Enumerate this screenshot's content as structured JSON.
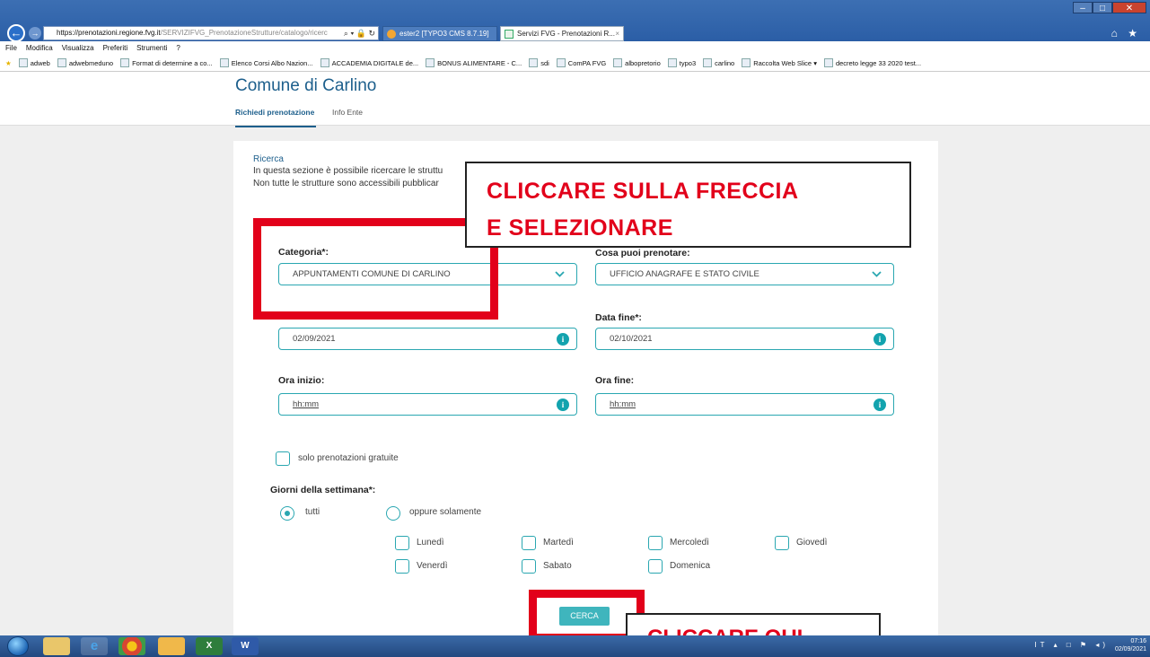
{
  "browser": {
    "url_host": "https://prenotazioni.regione.fvg.it",
    "url_rest": "/SERVIZIFVG_PrenotazioneStrutture/catalogo/ricerc",
    "url_icons": "⌕ ▾ 🔒 ↻",
    "tabs": [
      {
        "label": "ester2 [TYPO3 CMS 8.7.19]"
      },
      {
        "label": "Servizi FVG - Prenotazioni R...",
        "close": "×"
      }
    ],
    "right_icons": "⌂ ★",
    "window_controls": {
      "minimize": "–",
      "maximize": "□",
      "close": "✕"
    },
    "menu": [
      "File",
      "Modifica",
      "Visualizza",
      "Preferiti",
      "Strumenti",
      "?"
    ],
    "favorites": [
      "adweb",
      "adwebmeduno",
      "Format di determine a co...",
      "Elenco Corsi Albo Nazion...",
      "ACCADEMIA DIGITALE de...",
      "BONUS ALIMENTARE - C...",
      "sdi",
      "ComPA FVG",
      "albopretorio",
      "typo3",
      "carlino",
      "Raccolta Web Slice ▾",
      "decreto legge 33 2020 test..."
    ]
  },
  "page": {
    "title": "Comune di Carlino",
    "tabs": {
      "active": "Richiedi prenotazione",
      "inactive": "Info Ente"
    }
  },
  "search": {
    "section_title": "Ricerca",
    "intro_line1": "In questa sezione è possibile ricercare le struttu",
    "intro_line2": "Non tutte le strutture sono accessibili pubblicar",
    "categoria_label": "Categoria*:",
    "categoria_value": "APPUNTAMENTI COMUNE DI CARLINO",
    "cosa_label": "Cosa puoi prenotare:",
    "cosa_value": "UFFICIO ANAGRAFE E STATO CIVILE",
    "data_fine_label": "Data fine*:",
    "data_inizio_value": "02/09/2021",
    "data_fine_value": "02/10/2021",
    "ora_inizio_label": "Ora inizio:",
    "ora_fine_label": "Ora fine:",
    "ora_placeholder": "hh:mm",
    "info_glyph": "i",
    "gratuite_label": "solo prenotazioni gratuite",
    "giorni_label": "Giorni della settimana*:",
    "radio_tutti": "tutti",
    "radio_solamente": "oppure solamente",
    "days": [
      "Lunedì",
      "Martedì",
      "Mercoledì",
      "Giovedì",
      "Venerdì",
      "Sabato",
      "Domenica"
    ],
    "cerca_label": "CERCA"
  },
  "annotations": {
    "main_line1": "CLICCARE  SULLA  FRECCIA",
    "main_line2": "E SELEZIONARE",
    "bottom": "CLICCARE QUI",
    "color": "#e2001a"
  },
  "taskbar": {
    "apps": [
      "",
      "",
      "e",
      "",
      "",
      "X",
      "W"
    ],
    "tray_icons": "IT ▴ □ ⚑ ◂)",
    "time": "07:16",
    "date": "02/09/2021"
  },
  "colors": {
    "accent": "#2aa7b1",
    "title": "#1d5f8c",
    "button": "#3fb5bd"
  }
}
